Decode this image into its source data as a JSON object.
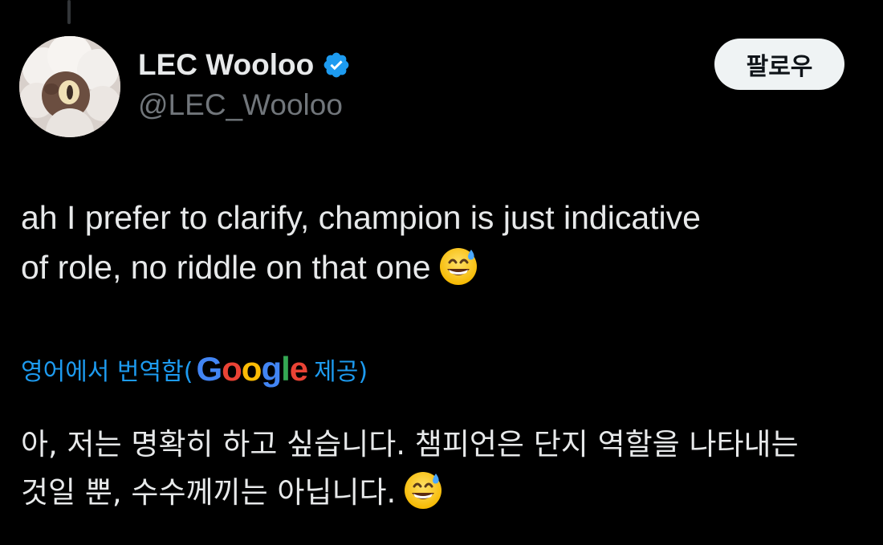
{
  "author": {
    "display_name": "LEC Wooloo",
    "handle": "@LEC_Wooloo",
    "verified_icon": "verified-badge-icon"
  },
  "follow_button": {
    "label": "팔로우"
  },
  "tweet": {
    "line1": "ah I prefer to clarify, champion is just indicative",
    "line2": "of role, no riddle on that one",
    "emoji": "grinning-sweat-emoji"
  },
  "translation": {
    "prefix": "영어에서 번역함(",
    "google": [
      "G",
      "o",
      "o",
      "g",
      "l",
      "e"
    ],
    "suffix": " 제공)",
    "line1": "아, 저는 명확히 하고 싶습니다. 챔피언은 단지 역할을 나타내는",
    "line2": "것일 뿐, 수수께끼는 아닙니다."
  },
  "colors": {
    "background": "#000000",
    "text": "#e7e9ea",
    "secondary": "#71767b",
    "link": "#1d9bf0",
    "verified": "#1d9bf0"
  }
}
